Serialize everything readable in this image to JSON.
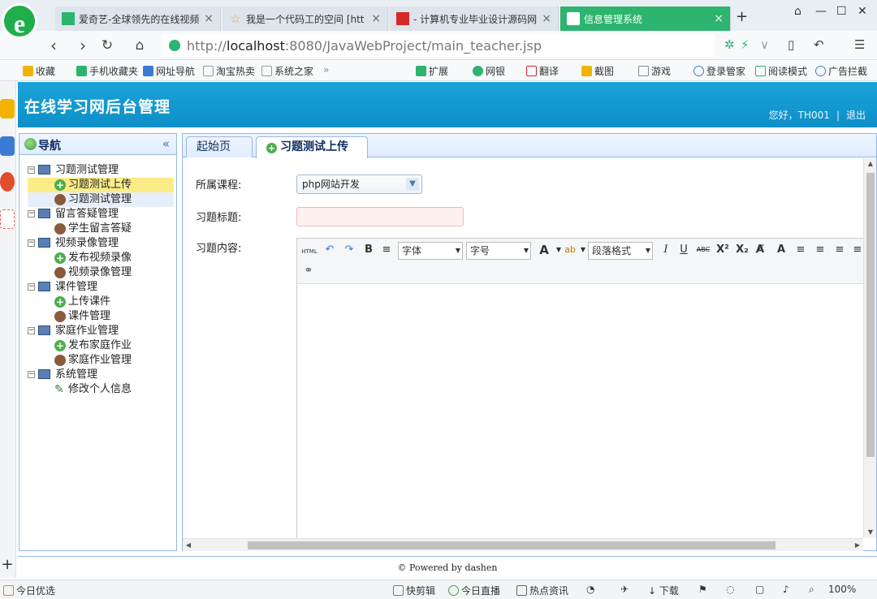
{
  "browser": {
    "logo": "e",
    "tabs": [
      {
        "title": "爱奇艺-全球领先的在线视频",
        "icon_text": "iQIYI",
        "icon_color": "#2db46e",
        "active": false
      },
      {
        "title": "我是一个代码工的空间 [htt",
        "icon_text": "☆",
        "icon_color": "#f0b400",
        "active": false
      },
      {
        "title": "- 计算机专业毕业设计源码网",
        "icon_text": "",
        "icon_color": "#d62828",
        "active": false
      },
      {
        "title": "信息管理系统",
        "icon_text": "",
        "icon_color": "#ffffff",
        "active": true
      }
    ],
    "new_tab_label": "+",
    "address": {
      "scheme": "http://",
      "host": "localhost",
      "rest": ":8080/JavaWebProject/main_teacher.jsp"
    },
    "bookmarks": [
      {
        "label": "收藏",
        "icon_color": "#f0b400"
      },
      {
        "label": "手机收藏夹",
        "icon_color": "#2db46e"
      },
      {
        "label": "网址导航",
        "icon_color": "#3a7bd5"
      },
      {
        "label": "淘宝热卖",
        "icon_color": "#999999"
      },
      {
        "label": "系统之家",
        "icon_color": "#999999"
      },
      {
        "label": "扩展",
        "icon_color": "#2db46e"
      },
      {
        "label": "网银",
        "icon_color": "#2db46e"
      },
      {
        "label": "翻译",
        "icon_color": "#d62828"
      },
      {
        "label": "截图",
        "icon_color": "#f0b400"
      },
      {
        "label": "游戏",
        "icon_color": "#888888"
      },
      {
        "label": "登录管家",
        "icon_color": "#3a7bd5"
      },
      {
        "label": "阅读模式",
        "icon_color": "#2db46e"
      },
      {
        "label": "广告拦截",
        "icon_color": "#3a7bd5"
      }
    ],
    "status_bar": {
      "left": "今日优选",
      "items": [
        "快剪辑",
        "今日直播",
        "热点资讯",
        "下载"
      ],
      "zoom": "100%"
    }
  },
  "site": {
    "title": "在线学习网后台管理",
    "greeting": "您好，TH001",
    "logout": "退出",
    "footer": "© Powered by dashen"
  },
  "nav": {
    "title": "导航",
    "collapse_glyph": "«",
    "groups": [
      {
        "label": "习题测试管理",
        "children": [
          {
            "label": "习题测试上传",
            "icon": "add",
            "selected": true
          },
          {
            "label": "习题测试管理",
            "icon": "user",
            "hover": true
          }
        ]
      },
      {
        "label": "留言答疑管理",
        "children": [
          {
            "label": "学生留言答疑",
            "icon": "user"
          }
        ]
      },
      {
        "label": "视频录像管理",
        "children": [
          {
            "label": "发布视频录像",
            "icon": "add"
          },
          {
            "label": "视频录像管理",
            "icon": "user"
          }
        ]
      },
      {
        "label": "课件管理",
        "children": [
          {
            "label": "上传课件",
            "icon": "add"
          },
          {
            "label": "课件管理",
            "icon": "user"
          }
        ]
      },
      {
        "label": "家庭作业管理",
        "children": [
          {
            "label": "发布家庭作业",
            "icon": "add"
          },
          {
            "label": "家庭作业管理",
            "icon": "user"
          }
        ]
      },
      {
        "label": "系统管理",
        "children": [
          {
            "label": "修改个人信息",
            "icon": "pencil"
          }
        ]
      }
    ]
  },
  "main": {
    "tabs": [
      {
        "label": "起始页",
        "active": false
      },
      {
        "label": "习题测试上传",
        "active": true,
        "closable": true
      }
    ],
    "form": {
      "course_label": "所属课程:",
      "course_value": "php网站开发",
      "title_label": "习题标题:",
      "title_value": "",
      "content_label": "习题内容:"
    },
    "editor_toolbar": {
      "html": "HTML",
      "font": "字体",
      "size": "字号",
      "paragraph": "段落格式",
      "bold": "B",
      "italic": "I",
      "underline": "U",
      "strike": "ABC",
      "superscript": "X²",
      "subscript": "X₂"
    }
  }
}
